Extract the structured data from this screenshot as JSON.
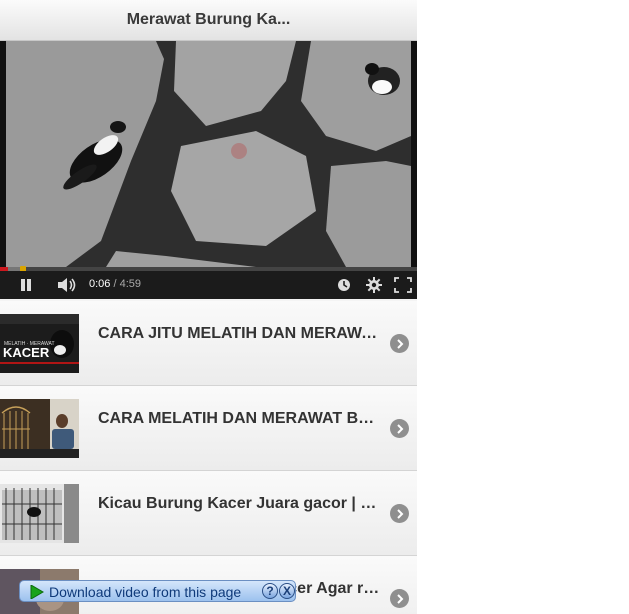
{
  "header": {
    "title": "Merawat Burung Ka..."
  },
  "player": {
    "current_time": "0:06",
    "separator": " / ",
    "duration": "4:59",
    "played_fraction": 0.02,
    "loaded_fraction": 0.05
  },
  "list": {
    "items": [
      {
        "title": "CARA JITU MELATIH DAN MERAWAT BURUNG KACER",
        "thumb_caption_small": "MELATIH · MERAWAT",
        "thumb_caption": "KACER"
      },
      {
        "title": "CARA MELATIH DAN MERAWAT BURUNG KACER"
      },
      {
        "title": "Kicau Burung Kacer Juara gacor | Kicau Burung"
      },
      {
        "title": "Cara Merawat Burung Kacer Agar rajin Bunyi"
      }
    ]
  },
  "download_bar": {
    "label": "Download video from this page",
    "help": "?",
    "close": "X"
  }
}
